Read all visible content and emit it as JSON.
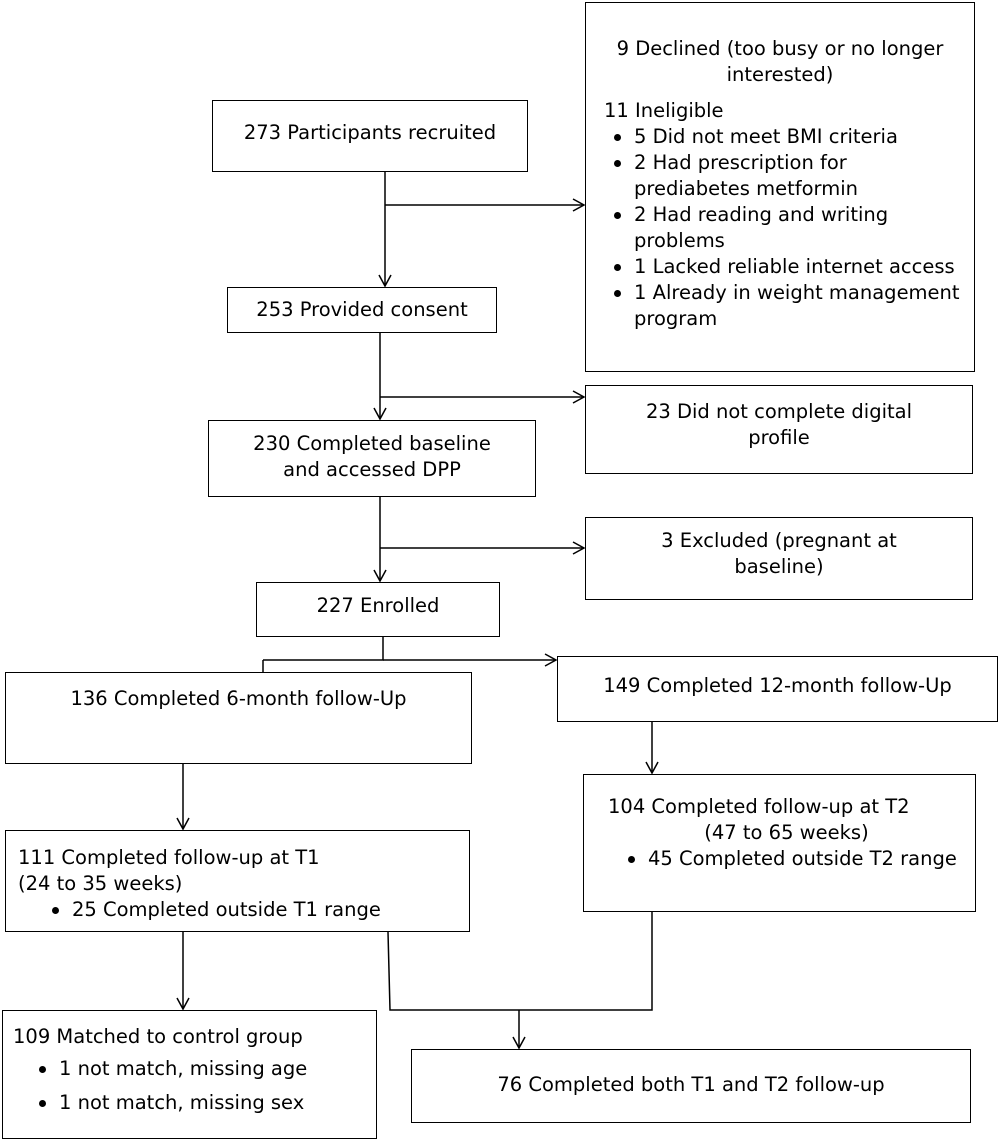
{
  "recruited": "273 Participants recruited",
  "excluded1": {
    "declined": "9 Declined (too busy or no longer interested)",
    "ineligible": "11 Ineligible",
    "reasons": [
      "5 Did not meet BMI criteria",
      "2 Had prescription for prediabetes metformin",
      "2 Had reading and writing problems",
      "1 Lacked reliable internet access",
      "1 Already in weight management program"
    ]
  },
  "consent": "253 Provided consent",
  "excluded2": "23 Did not complete digital profile",
  "baseline": [
    "230 Completed baseline",
    "and accessed DPP"
  ],
  "excluded3": "3 Excluded (pregnant at baseline)",
  "enrolled": "227 Enrolled",
  "followup12": "149 Completed 12-month follow-Up",
  "followup6": "136 Completed 6-month follow-Up",
  "t2": {
    "title": "104 Completed follow-up at T2",
    "range": "(47 to 65 weeks)",
    "bullet": "45 Completed outside T2 range"
  },
  "t1": {
    "title": "111 Completed follow-up at T1",
    "range": "(24 to 35 weeks)",
    "bullet": "25 Completed outside T1 range"
  },
  "matched": {
    "title": "109 Matched to control group",
    "bullets": [
      "1 not match, missing age",
      "1 not match, missing sex"
    ]
  },
  "both": "76 Completed both T1 and T2 follow-up"
}
